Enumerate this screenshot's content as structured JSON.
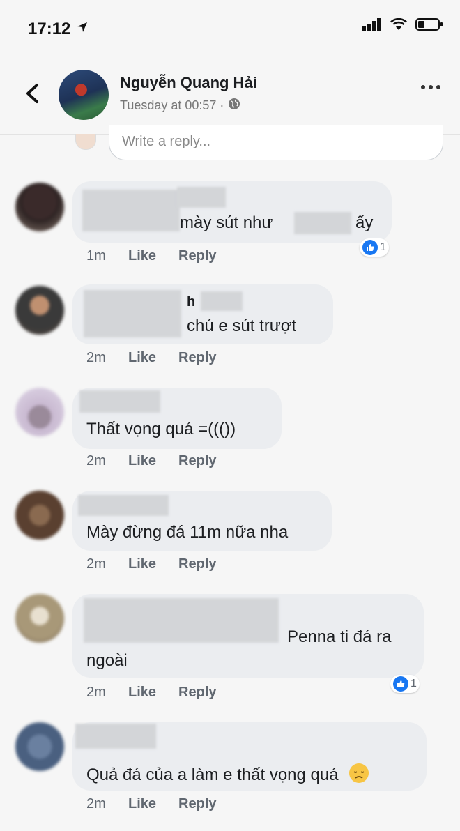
{
  "status": {
    "time": "17:12"
  },
  "header": {
    "name": "Nguyễn Quang Hải",
    "subtitle": "Tuesday at 00:57 ·"
  },
  "reply_box": {
    "placeholder": "Write a reply..."
  },
  "actions": {
    "like": "Like",
    "reply": "Reply"
  },
  "comments": [
    {
      "line1": "mày sút như",
      "line1_end": "ấy",
      "time": "1m",
      "reactions": "1"
    },
    {
      "line0": "h",
      "line1": "chú e sút trượt",
      "time": "2m"
    },
    {
      "line1": "Thất vọng quá =((())",
      "time": "2m"
    },
    {
      "line1": "Mày đừng đá 11m nữa nha",
      "time": "2m"
    },
    {
      "line1": "Penna ti đá ra",
      "line2": "ngoài",
      "time": "2m",
      "reactions": "1"
    },
    {
      "line1": "Quả đá của a làm e thất vọng quá",
      "time": "2m"
    }
  ],
  "colors": {
    "like_blue": "#1877f2",
    "bubble_bg": "#ebedf0",
    "meta_text": "#606770"
  }
}
